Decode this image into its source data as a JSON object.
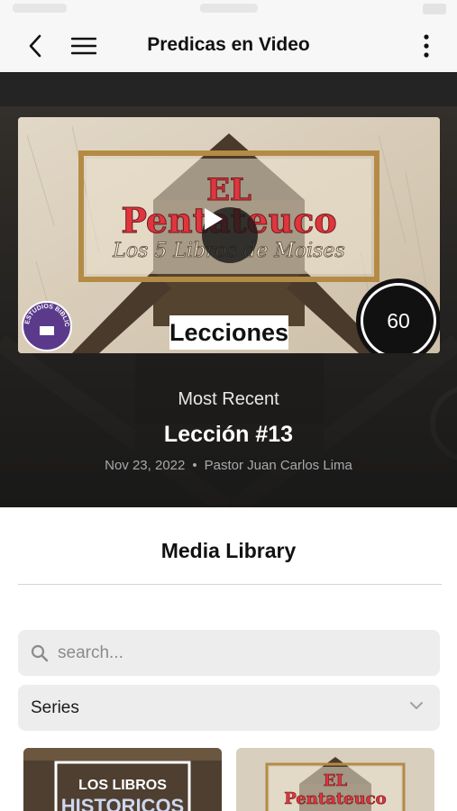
{
  "nav": {
    "title": "Predicas en Video",
    "back_icon": "chevron-left-icon",
    "menu_icon": "hamburger-icon",
    "more_icon": "more-vertical-icon"
  },
  "hero": {
    "thumbnail": {
      "title_line1": "EL",
      "title_line2": "Pentateuco",
      "subtitle": "Los 5 Libros de Moises",
      "badge_text": "Lecciones",
      "logo_text": "ESTUDIOS BIBLICOS",
      "duration": "60"
    },
    "kicker": "Most Recent",
    "title": "Lección #13",
    "date": "Nov 23, 2022",
    "separator": "•",
    "speaker": "Pastor Juan Carlos Lima"
  },
  "library": {
    "title": "Media Library",
    "search_placeholder": "search...",
    "filter_value": "Series"
  },
  "cards": [
    {
      "title_line1": "LOS LIBROS",
      "title_line2": "HISTORICOS"
    },
    {
      "title_line1": "EL",
      "title_line2": "Pentateuco"
    }
  ],
  "colors": {
    "accent_red": "#e0353f",
    "gold": "#b48b45",
    "logo_purple": "#5b3a8c"
  }
}
